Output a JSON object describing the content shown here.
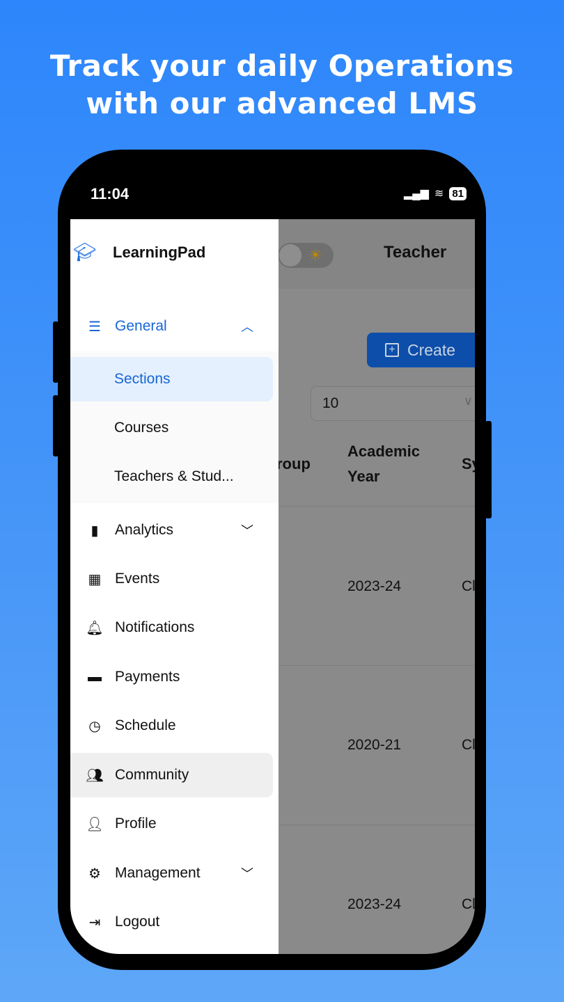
{
  "headline": [
    "Track your daily Operations",
    "with our advanced LMS"
  ],
  "status": {
    "time": "11:04",
    "battery": "81"
  },
  "app": {
    "brand": "LearningPad",
    "role": "Teacher",
    "create_label": "Create",
    "page_size": "10",
    "columns": [
      "roup",
      "Academic Year",
      "Sy"
    ],
    "rows": [
      {
        "year": "2023-24",
        "next": "Cl"
      },
      {
        "year": "2020-21",
        "next": "Cl"
      },
      {
        "year": "2023-24",
        "next": "Cl"
      }
    ]
  },
  "drawer": {
    "general": {
      "label": "General",
      "icon": "list-icon",
      "expanded": true,
      "children": [
        "Sections",
        "Courses",
        "Teachers & Stud..."
      ],
      "active": "Sections"
    },
    "items": [
      {
        "label": "Analytics",
        "icon": "bar-chart-icon",
        "chevron": true
      },
      {
        "label": "Events",
        "icon": "calendar-icon"
      },
      {
        "label": "Notifications",
        "icon": "bell-icon"
      },
      {
        "label": "Payments",
        "icon": "credit-card-icon"
      },
      {
        "label": "Schedule",
        "icon": "clock-icon"
      },
      {
        "label": "Community",
        "icon": "users-icon",
        "highlighted": true
      },
      {
        "label": "Profile",
        "icon": "user-icon"
      },
      {
        "label": "Management",
        "icon": "gears-icon",
        "chevron": true
      },
      {
        "label": "Logout",
        "icon": "logout-icon"
      }
    ]
  },
  "colors": {
    "accent": "#1766d6",
    "background": "#2d86fb",
    "create_button": "#0d4eaa"
  }
}
